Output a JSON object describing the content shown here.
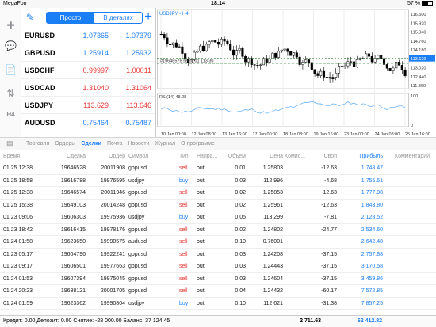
{
  "status": {
    "carrier": "MegaFon",
    "time": "18:14",
    "battery": "57 %",
    "battery_level": 0.57
  },
  "sidebar_icons": [
    "pencil-icon",
    "crosshair-icon",
    "chat-icon",
    "document-icon",
    "trade-icon",
    "timeframe-icon"
  ],
  "timeframe_label": "H4",
  "quotes": {
    "tabs": [
      "Просто",
      "В деталях"
    ],
    "active_tab": 0,
    "rows": [
      {
        "symbol": "EURUSD",
        "bid": "1.07365",
        "ask": "1.07379",
        "color": "blue"
      },
      {
        "symbol": "GBPUSD",
        "bid": "1.25914",
        "ask": "1.25932",
        "color": "blue"
      },
      {
        "symbol": "USDCHF",
        "bid": "0.99997",
        "ask": "1.00011",
        "color": "red"
      },
      {
        "symbol": "USDCAD",
        "bid": "1.31040",
        "ask": "1.31064",
        "color": "red"
      },
      {
        "symbol": "USDJPY",
        "bid": "113.629",
        "ask": "113.646",
        "color": "red"
      },
      {
        "symbol": "AUDUSD",
        "bid": "0.75464",
        "ask": "0.75487",
        "color": "blue"
      }
    ]
  },
  "chart_panel": {
    "symbol_label": "USDJPY • H4",
    "price_axis": [
      "116.500",
      "115.920",
      "115.340",
      "114.760",
      "114.180",
      "113.620",
      "113.020",
      "112.440",
      "111.860"
    ],
    "current_price": "113.629",
    "rsi_label": "RSI(14) 48.28",
    "rsi_axis": [
      "100",
      "0"
    ],
    "time_axis": [
      "10 Jan 00:00",
      "12 Jan 08:00",
      "13 Jan 16:00",
      "17 Jan 00:00",
      "18 Jan 08:00",
      "19 Jan 16:00",
      "23 Jan 00:00",
      "24 Jan 08:00",
      "25 Jan 16:00"
    ],
    "order_label": "#19646576 sell 0.01  113.30"
  },
  "tabs": {
    "items": [
      "Торговля",
      "Ордеры",
      "Сделки",
      "Почта",
      "Новости",
      "Журнал",
      "О программе"
    ],
    "active": 2
  },
  "table": {
    "headers": [
      "Время",
      "Сделка",
      "Ордер",
      "Символ",
      "Тип",
      "Напра...",
      "Объем",
      "Цена",
      "Комис...",
      "Своп",
      "Прибыль",
      "Комментарий"
    ],
    "rows": [
      [
        "01.25 12:38",
        "19646528",
        "20011908",
        "gbpusd",
        "sell",
        "out",
        "0.01",
        "1.25803",
        "",
        "-12.63",
        "1 748.47"
      ],
      [
        "01.25 18:58",
        "19616788",
        "19976595",
        "usdjpy",
        "buy",
        "out",
        "0.03",
        "112.996",
        "",
        "-4.68",
        "1 755.61"
      ],
      [
        "01.25 12:38",
        "19646574",
        "20011946",
        "gbpusd",
        "sell",
        "out",
        "0.02",
        "1.25853",
        "",
        "-12.63",
        "1 777.98"
      ],
      [
        "01.25 15:38",
        "19649103",
        "20014248",
        "gbpusd",
        "sell",
        "out",
        "0.02",
        "1.25961",
        "",
        "-12.63",
        "1 843.80"
      ],
      [
        "01.23 09:06",
        "19606303",
        "19975936",
        "usdjpy",
        "buy",
        "out",
        "0.05",
        "113.299",
        "",
        "-7.81",
        "2 128.52"
      ],
      [
        "01.23 18:42",
        "19616415",
        "19978176",
        "gbpusd",
        "sell",
        "out",
        "0.02",
        "1.24802",
        "",
        "-24.77",
        "2 534.60"
      ],
      [
        "01.24 01:58",
        "19623650",
        "19990575",
        "audusd",
        "sell",
        "out",
        "0.10",
        "0.76001",
        "",
        "",
        "2 642.48"
      ],
      [
        "01.23 05:17",
        "19604796",
        "19922241",
        "gbpusd",
        "sell",
        "out",
        "0.03",
        "1.24208",
        "",
        "-37.15",
        "2 757.88"
      ],
      [
        "01.23 09:17",
        "19606501",
        "19977663",
        "gbpusd",
        "sell",
        "out",
        "0.03",
        "1.24443",
        "",
        "-37.15",
        "3 170.58"
      ],
      [
        "01.24 01:53",
        "19607394",
        "19975045",
        "gbpusd",
        "sell",
        "out",
        "0.03",
        "1.24604",
        "",
        "-37.15",
        "3 459.86"
      ],
      [
        "01.24 20:23",
        "19638121",
        "20001705",
        "gbpusd",
        "sell",
        "out",
        "0.04",
        "1.24432",
        "",
        "-60.17",
        "7 572.85"
      ],
      [
        "01.24 01:59",
        "19623362",
        "19990804",
        "usdjpy",
        "buy",
        "out",
        "0.10",
        "112.621",
        "",
        "-31.38",
        "7 857.25"
      ]
    ]
  },
  "footer": {
    "summary": "Кредит: 0.00 Депозит: 0.00 Снятие: -28 000.00 Баланс: 37 124.45",
    "swap_total": "2 711.63",
    "profit_total": "62 412.82"
  },
  "colors": {
    "accent": "#1a7ef5",
    "sell": "#e53935",
    "bull": "#ffffff",
    "bear": "#000000",
    "rsi": "#5aa9f5"
  }
}
